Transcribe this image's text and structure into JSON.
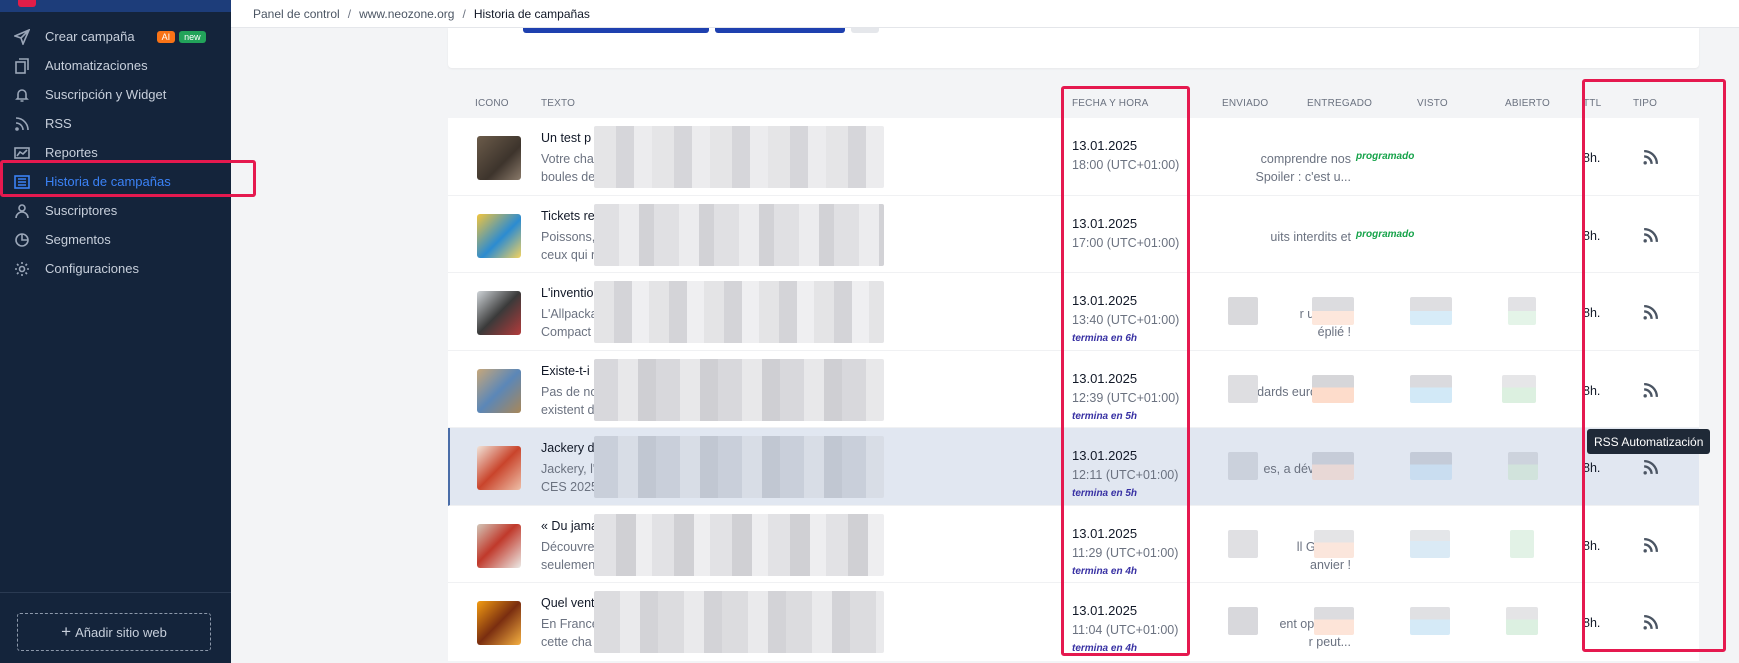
{
  "sidebar": {
    "items": [
      {
        "label": "Crear campaña",
        "icon": "send-icon",
        "badges": [
          "AI",
          "new"
        ]
      },
      {
        "label": "Automatizaciones",
        "icon": "automation-icon"
      },
      {
        "label": "Suscripción y Widget",
        "icon": "bell-icon"
      },
      {
        "label": "RSS",
        "icon": "rss-icon"
      },
      {
        "label": "Reportes",
        "icon": "chart-icon"
      },
      {
        "label": "Historia de campañas",
        "icon": "list-icon",
        "active": true
      },
      {
        "label": "Suscriptores",
        "icon": "users-icon"
      },
      {
        "label": "Segmentos",
        "icon": "segment-icon"
      },
      {
        "label": "Configuraciones",
        "icon": "gear-icon"
      }
    ],
    "add_site_label": "Añadir sitio web"
  },
  "breadcrumb": {
    "items": [
      "Panel de control",
      "www.neozone.org"
    ],
    "current": "Historia de campañas",
    "separator": "/"
  },
  "table": {
    "headers": {
      "icon": "ICONO",
      "text": "TEXTO",
      "datetime": "FECHA Y HORA",
      "sent": "ENVIADO",
      "delivered": "ENTREGADO",
      "seen": "VISTO",
      "opened": "ABIERTO",
      "ttl": "TTL",
      "type": "TIPO"
    },
    "rows": [
      {
        "title": "Un test p",
        "desc_left_1": "Votre cha",
        "desc_left_2": "boules de",
        "desc_right_1": "comprendre nos",
        "desc_right_2": "Spoiler : c'est u...",
        "date": "13.01.2025",
        "time": "18:00 (UTC+01:00)",
        "ends": "",
        "status": "programado",
        "ttl": "8h."
      },
      {
        "title": "Tickets re",
        "desc_left_1": "Poissons,",
        "desc_left_2": "ceux qui n",
        "desc_right_1": "uits interdits et",
        "desc_right_2": "",
        "date": "13.01.2025",
        "time": "17:00 (UTC+01:00)",
        "ends": "",
        "status": "programado",
        "ttl": "8h."
      },
      {
        "title": "L'inventio",
        "desc_left_1": "L'Allpacka",
        "desc_left_2": "Compact",
        "desc_right_1": "r un vélo.",
        "desc_right_2": "éplié !",
        "date": "13.01.2025",
        "time": "13:40 (UTC+01:00)",
        "ends": "termina en 6h",
        "status": "",
        "ttl": "8h."
      },
      {
        "title": "Existe-t-i",
        "desc_left_1": "Pas de no",
        "desc_left_2": "existent d",
        "desc_right_1": "dards européens",
        "desc_right_2": "",
        "date": "13.01.2025",
        "time": "12:39 (UTC+01:00)",
        "ends": "termina en 5h",
        "status": "",
        "ttl": "8h."
      },
      {
        "title": "Jackery d",
        "desc_left_1": "Jackery, l'",
        "desc_left_2": "CES 2025",
        "desc_right_1": "es, a dévoilé au",
        "desc_right_2": "",
        "date": "13.01.2025",
        "time": "12:11 (UTC+01:00)",
        "ends": "termina en 5h",
        "status": "",
        "ttl": "8h."
      },
      {
        "title": "« Du jama",
        "desc_left_1": "Découvre",
        "desc_left_2": "seulemen",
        "desc_right_1": "ll Green à",
        "desc_right_2": "anvier !",
        "date": "13.01.2025",
        "time": "11:29 (UTC+01:00)",
        "ends": "termina en 4h",
        "status": "",
        "ttl": "8h."
      },
      {
        "title": "Quel vent",
        "desc_left_1": "En France",
        "desc_left_2": "cette cha",
        "desc_right_1": "ent optimiser",
        "desc_right_2": "r peut...",
        "date": "13.01.2025",
        "time": "11:04 (UTC+01:00)",
        "ends": "termina en 4h",
        "status": "",
        "ttl": "8h."
      }
    ]
  },
  "tooltip": {
    "text": "RSS Automatización"
  },
  "colors": {
    "sidebar_bg": "#14243b",
    "accent": "#3b82f6",
    "highlight": "#e5194f",
    "status_green": "#16a34a",
    "ends_purple": "#3730a3"
  }
}
